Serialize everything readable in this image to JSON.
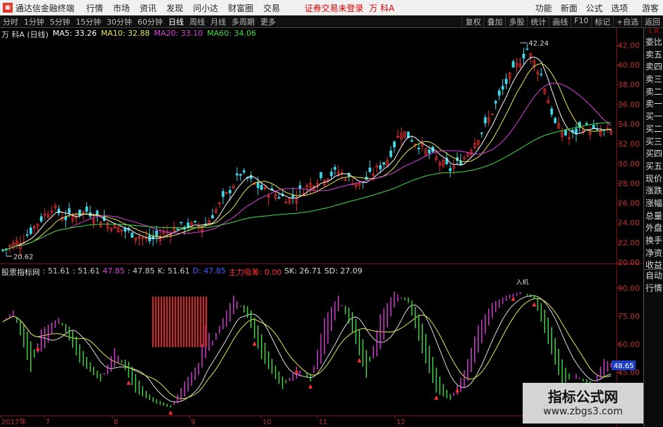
{
  "menubar": {
    "app_title": "通达信金融终端",
    "items": [
      "行情",
      "市场",
      "资讯",
      "发现",
      "问小达",
      "财富圈",
      "交易"
    ],
    "notice": "证券交易未登录",
    "stock": "万 科A",
    "right": [
      "功能",
      "新面",
      "公式",
      "选项",
      "游客"
    ]
  },
  "toolbar": {
    "periods": [
      "分时",
      "1分钟",
      "5分钟",
      "15分钟",
      "30分钟",
      "60分钟",
      "日线",
      "周线",
      "月线",
      "多周期",
      "更多"
    ],
    "active": "日线",
    "right": [
      "复权",
      "叠加",
      "多股",
      "统计",
      "画线",
      "F10",
      "标记",
      "+自选",
      "返回"
    ]
  },
  "main_legend": {
    "stock": "万 科A (日线)",
    "ma": [
      {
        "label": "MA5: 33.26",
        "color": "#ffffff"
      },
      {
        "label": "MA10: 32.88",
        "color": "#e8e84a"
      },
      {
        "label": "MA20: 33.10",
        "color": "#e040e0"
      },
      {
        "label": "MA60: 34.06",
        "color": "#40e040"
      }
    ]
  },
  "indicator_legend": {
    "name": "股票指标网",
    "items": [
      {
        "label": ": 51.61",
        "color": "#cccccc"
      },
      {
        "label": ": 51.61",
        "color": "#cccccc"
      },
      {
        "label": "47.85",
        "color": "#e040e0"
      },
      {
        "label": ": 47.85",
        "color": "#cccccc"
      },
      {
        "label": "K: 51.61",
        "color": "#cccccc"
      },
      {
        "label": "D: 47.85",
        "color": "#4060ff"
      },
      {
        "label": "主力吸筹: 0.00",
        "color": "#ff3030"
      },
      {
        "label": "SK: 26.71",
        "color": "#dddddd"
      },
      {
        "label": "SD: 27.09",
        "color": "#dddddd"
      }
    ]
  },
  "price_axis": [
    "42.00",
    "40.00",
    "38.00",
    "36.00",
    "34.00",
    "32.00",
    "30.00",
    "28.00",
    "26.00",
    "24.00",
    "22.00",
    "20.00"
  ],
  "ind_axis": [
    "90.00",
    "75.00",
    "60.00",
    "45.00"
  ],
  "ind_current": "48.65",
  "x_labels": [
    {
      "t": "2017年"
    },
    {
      "t": "7"
    },
    {
      "t": "8"
    },
    {
      "t": "9"
    },
    {
      "t": "10"
    },
    {
      "t": "11"
    },
    {
      "t": "12"
    }
  ],
  "annotations": {
    "high": "42.24",
    "low": "20.62",
    "top_tag": "入机"
  },
  "sidebar": {
    "top": "L R",
    "items": [
      "委比",
      "卖五",
      "卖四",
      "卖三",
      "卖二",
      "卖一",
      "买一",
      "买二",
      "买三",
      "买四",
      "买五",
      "现价",
      "涨跌",
      "涨幅",
      "总量",
      "外盘",
      "换手",
      "净资",
      "收益"
    ],
    "bottom": [
      "自动",
      "行情"
    ]
  },
  "watermark": {
    "title": "指标公式网",
    "url": "www.zbgs3.com"
  }
}
